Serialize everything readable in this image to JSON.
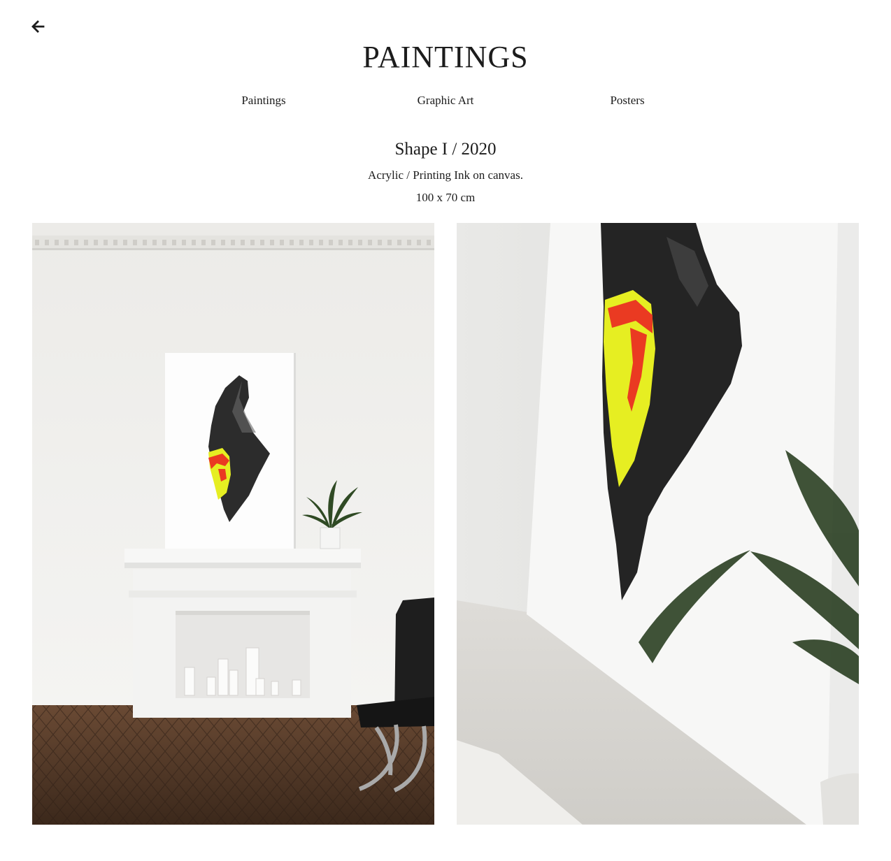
{
  "header": {
    "back_icon": "arrow-left-icon",
    "title": "PAINTINGS"
  },
  "nav": {
    "items": [
      {
        "label": "Paintings"
      },
      {
        "label": "Graphic Art"
      },
      {
        "label": "Posters"
      }
    ]
  },
  "artwork": {
    "title": "Shape I / 2020",
    "medium": "Acrylic / Printing Ink on canvas.",
    "size": "100 x 70 cm"
  },
  "photos": [
    {
      "name": "interior-view"
    },
    {
      "name": "close-up-view"
    }
  ],
  "colors": {
    "text": "#1c1c1c",
    "accent_yellow": "#e6ee22",
    "accent_red": "#ea3a22"
  }
}
